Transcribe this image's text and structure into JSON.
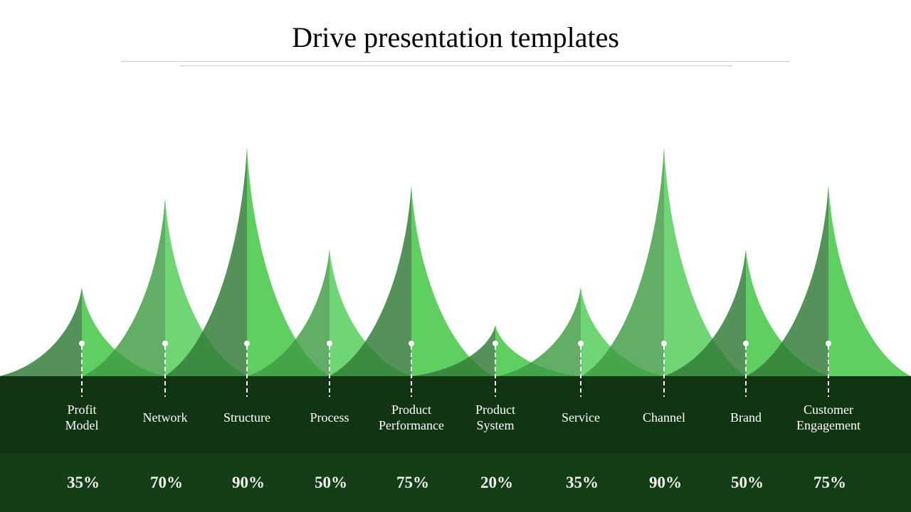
{
  "slide": {
    "title": "Drive presentation templates"
  },
  "colors": {
    "left_face": "#2f7a35",
    "right_face": "#3cc43f",
    "band_top": "#113513",
    "band_bottom": "#143e15",
    "marker": "#ffffff"
  },
  "chart_data": {
    "type": "area",
    "title": "Drive presentation templates",
    "xlabel": "",
    "ylabel": "",
    "ylim": [
      0,
      100
    ],
    "unit": "%",
    "grid": false,
    "legend": "none",
    "categories": [
      "Profit Model",
      "Network",
      "Structure",
      "Process",
      "Product Performance",
      "Product System",
      "Service",
      "Channel",
      "Brand",
      "Customer Engagement"
    ],
    "labels": [
      [
        "Profit",
        "Model"
      ],
      [
        "Network"
      ],
      [
        "Structure"
      ],
      [
        "Process"
      ],
      [
        "Product",
        "Performance"
      ],
      [
        "Product",
        "System"
      ],
      [
        "Service"
      ],
      [
        "Channel"
      ],
      [
        "Brand"
      ],
      [
        "Customer",
        "Engagement"
      ]
    ],
    "values": [
      35,
      70,
      90,
      50,
      75,
      20,
      35,
      90,
      50,
      75
    ],
    "value_labels": [
      "35%",
      "70%",
      "90%",
      "50%",
      "75%",
      "20%",
      "35%",
      "90%",
      "50%",
      "75%"
    ]
  }
}
